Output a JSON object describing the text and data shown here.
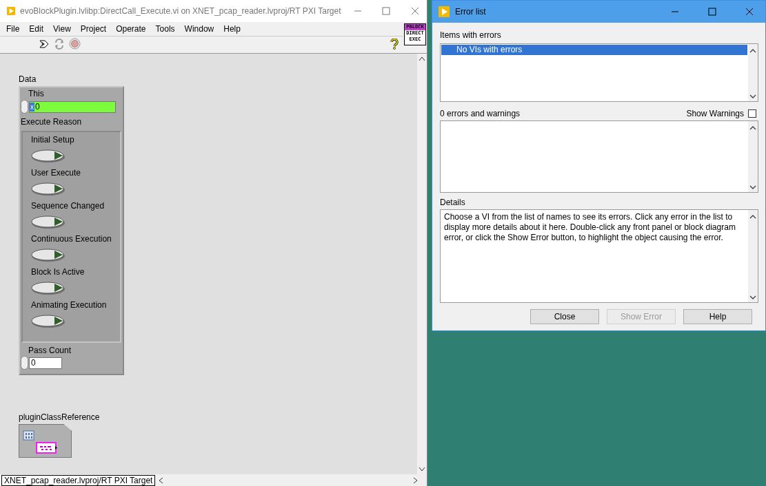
{
  "vi_window": {
    "title": "evoBlockPlugin.lvlibp:DirectCall_Execute.vi on XNET_pcap_reader.lvproj/RT PXI Target",
    "menu": [
      "File",
      "Edit",
      "View",
      "Project",
      "Operate",
      "Tools",
      "Window",
      "Help"
    ],
    "vi_icon": {
      "header": "PBLOCK",
      "lines": [
        "DIRECT",
        "EXEC"
      ]
    },
    "panel": {
      "cluster_label": "Data",
      "this": {
        "label": "This",
        "radix": "x",
        "value": "0"
      },
      "execute_reason": {
        "label": "Execute Reason",
        "items": [
          {
            "label": "Initial Setup",
            "on": false
          },
          {
            "label": "User Execute",
            "on": false
          },
          {
            "label": "Sequence Changed",
            "on": false
          },
          {
            "label": "Continuous Execution",
            "on": false
          },
          {
            "label": "Block Is Active",
            "on": false
          },
          {
            "label": "Animating Execution",
            "on": false
          }
        ]
      },
      "pass_count": {
        "label": "Pass Count",
        "value": "0"
      },
      "reference": {
        "label": "pluginClassReference"
      }
    },
    "status": "XNET_pcap_reader.lvproj/RT PXI Target"
  },
  "error_window": {
    "title": "Error list",
    "items_label": "Items with errors",
    "items": [
      {
        "label": "No VIs with errors",
        "selected": true
      }
    ],
    "count_label": "0 errors and warnings",
    "show_warnings": {
      "label": "Show Warnings",
      "checked": false
    },
    "details_label": "Details",
    "details": "Choose a VI from the list of names to see its errors. Click any error in the list to display more details about it here. Double-click any front panel or block diagram error, or click the Show Error button, to highlight the object causing the error.",
    "buttons": [
      {
        "label": "Close",
        "disabled": false
      },
      {
        "label": "Show Error",
        "disabled": true
      },
      {
        "label": "Help",
        "disabled": false
      }
    ]
  }
}
